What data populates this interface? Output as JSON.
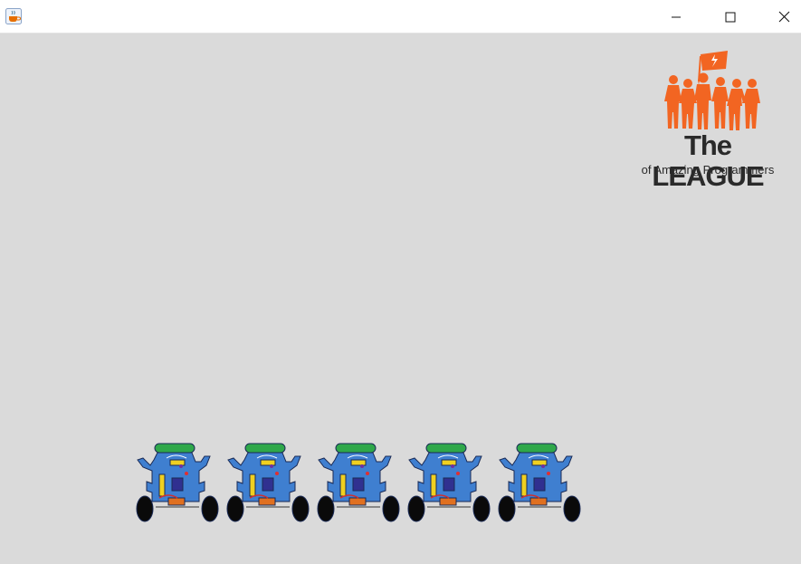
{
  "window": {
    "app_icon": "java-cup-icon",
    "controls": {
      "minimize_icon": "minimize-icon",
      "maximize_icon": "maximize-icon",
      "close_icon": "close-icon"
    }
  },
  "logo": {
    "title": "The LEAGUE",
    "subtitle": "of Amazing Programmers",
    "brand_color": "#f26522",
    "text_color": "#2a2a2a"
  },
  "canvas": {
    "background": "#dadada",
    "robots": [
      {
        "name": "robot-1"
      },
      {
        "name": "robot-2"
      },
      {
        "name": "robot-3"
      },
      {
        "name": "robot-4"
      },
      {
        "name": "robot-5"
      }
    ]
  },
  "colors": {
    "robot_body": "#3f7fd0",
    "robot_outline": "#1a2a55",
    "robot_head": "#2fa84a",
    "wheel": "#0a0a0a"
  }
}
